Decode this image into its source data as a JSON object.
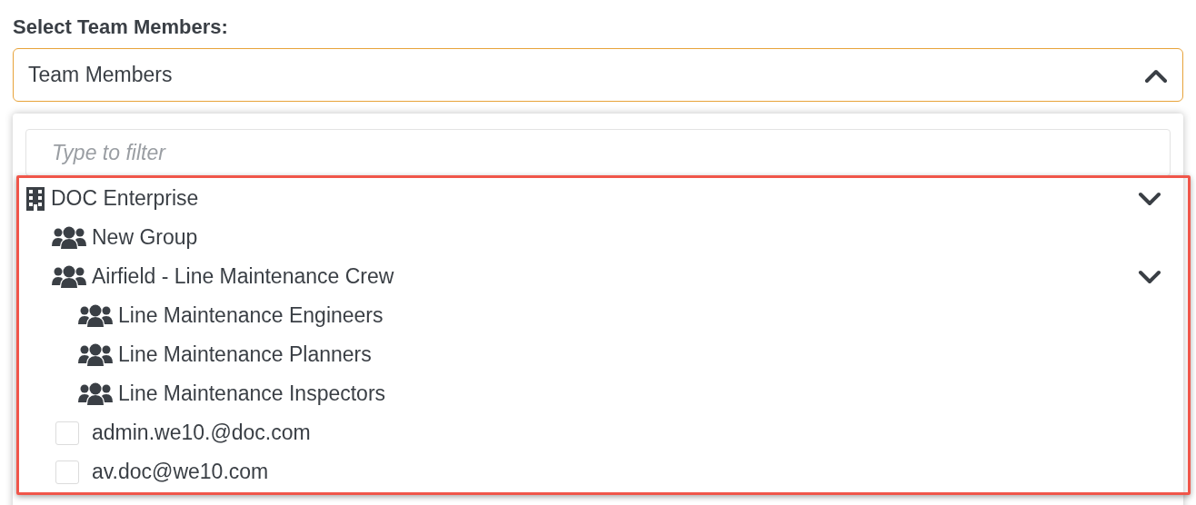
{
  "label": "Select Team Members:",
  "select": {
    "value": "Team Members",
    "expanded": true
  },
  "filter": {
    "placeholder": "Type to filter"
  },
  "tree": [
    {
      "kind": "enterprise",
      "label": "DOC Enterprise",
      "expanded": true,
      "children": [
        {
          "kind": "group",
          "label": "New Group"
        },
        {
          "kind": "group",
          "label": "Airfield - Line Maintenance Crew",
          "expanded": true,
          "children": [
            {
              "kind": "group",
              "label": "Line Maintenance Engineers"
            },
            {
              "kind": "group",
              "label": "Line Maintenance Planners"
            },
            {
              "kind": "group",
              "label": "Line Maintenance Inspectors"
            }
          ]
        },
        {
          "kind": "user",
          "label": "admin.we10.@doc.com",
          "checked": false
        },
        {
          "kind": "user",
          "label": "av.doc@we10.com",
          "checked": false
        }
      ]
    }
  ]
}
